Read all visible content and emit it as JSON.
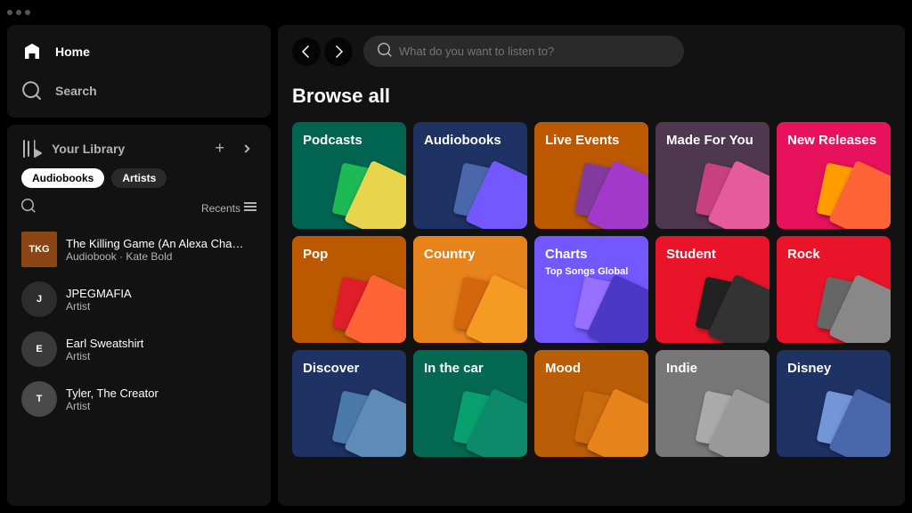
{
  "titlebar": {
    "dots": [
      "dot1",
      "dot2",
      "dot3"
    ]
  },
  "sidebar": {
    "nav": [
      {
        "id": "home",
        "label": "Home",
        "icon": "⌂"
      },
      {
        "id": "search",
        "label": "Search",
        "icon": "⌕"
      }
    ],
    "library": {
      "title": "Your Library",
      "add_label": "+",
      "expand_label": "→",
      "filters": [
        {
          "id": "audiobooks",
          "label": "Audiobooks",
          "active": true
        },
        {
          "id": "artists",
          "label": "Artists",
          "active": false
        }
      ],
      "search_label": "🔍",
      "recents_label": "Recents",
      "list_icon": "≡",
      "items": [
        {
          "id": "killing-game",
          "name": "The Killing Game (An Alexa Chase Suspens...",
          "sub": "Audiobook · Kate Bold",
          "type": "audiobook",
          "bg": "#8B4513",
          "initials": "TKG"
        },
        {
          "id": "jpegmafia",
          "name": "JPEGMAFIA",
          "sub": "Artist",
          "type": "artist",
          "bg": "#2d2d2d",
          "initials": "J"
        },
        {
          "id": "earl-sweatshirt",
          "name": "Earl Sweatshirt",
          "sub": "Artist",
          "type": "artist",
          "bg": "#3a3a3a",
          "initials": "E"
        },
        {
          "id": "tyler-the-creator",
          "name": "Tyler, The Creator",
          "sub": "Artist",
          "type": "artist",
          "bg": "#4a4a4a",
          "initials": "T"
        }
      ]
    }
  },
  "main": {
    "search_placeholder": "What do you want to listen to?",
    "browse_title": "Browse all",
    "categories": [
      {
        "id": "podcasts",
        "label": "Podcasts",
        "bg": "#006450",
        "thumb1_bg": "#e8d44d",
        "thumb2_bg": "#1db954"
      },
      {
        "id": "audiobooks",
        "label": "Audiobooks",
        "bg": "#1e3264",
        "thumb1_bg": "#7358ff",
        "thumb2_bg": "#4b67ac"
      },
      {
        "id": "live-events",
        "label": "Live Events",
        "bg": "#bc5900",
        "thumb1_bg": "#a239ca",
        "thumb2_bg": "#833b9e"
      },
      {
        "id": "made-for-you",
        "label": "Made For You",
        "bg": "#503750",
        "thumb1_bg": "#e55b9c",
        "thumb2_bg": "#c94080"
      },
      {
        "id": "new-releases",
        "label": "New Releases",
        "bg": "#e8115b",
        "thumb1_bg": "#ff6437",
        "thumb2_bg": "#ff9c00"
      },
      {
        "id": "pop",
        "label": "Pop",
        "bg": "#bc5900",
        "thumb1_bg": "#ff6437",
        "thumb2_bg": "#de1e28"
      },
      {
        "id": "country",
        "label": "Country",
        "bg": "#e8821a",
        "thumb1_bg": "#f59b23",
        "thumb2_bg": "#d4670e"
      },
      {
        "id": "charts",
        "label": "Charts",
        "bg": "#7358ff",
        "sub_label": "Top Songs Global",
        "thumb1_bg": "#4b39c5",
        "thumb2_bg": "#9870ff"
      },
      {
        "id": "student",
        "label": "Student",
        "bg": "#e91429",
        "thumb1_bg": "#333",
        "thumb2_bg": "#222"
      },
      {
        "id": "rock",
        "label": "Rock",
        "bg": "#e91429",
        "thumb1_bg": "#888",
        "thumb2_bg": "#666"
      },
      {
        "id": "discover",
        "label": "Discover",
        "bg": "#1e3264",
        "thumb1_bg": "#5f8bb8",
        "thumb2_bg": "#4a7aaa"
      },
      {
        "id": "in-the-car",
        "label": "In the car",
        "bg": "#056952",
        "thumb1_bg": "#0d8a6a",
        "thumb2_bg": "#09a070"
      },
      {
        "id": "mood",
        "label": "Mood",
        "bg": "#ba5d07",
        "thumb1_bg": "#e8821a",
        "thumb2_bg": "#c96a0e"
      },
      {
        "id": "indie",
        "label": "Indie",
        "bg": "#777777",
        "thumb1_bg": "#999",
        "thumb2_bg": "#aaa"
      },
      {
        "id": "disney",
        "label": "Disney",
        "bg": "#1e3264",
        "thumb1_bg": "#4b67ac",
        "thumb2_bg": "#7396d8"
      }
    ]
  }
}
